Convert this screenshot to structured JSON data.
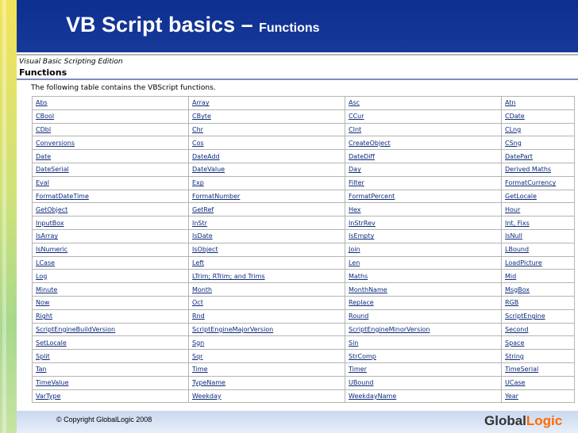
{
  "slide": {
    "title": "VB Script basics – ",
    "subtitle": "Functions"
  },
  "document": {
    "brand": "Visual Basic Scripting Edition",
    "heading": "Functions",
    "intro": "The following table contains the VBScript functions."
  },
  "functions_table": {
    "rows": [
      [
        "Abs",
        "Array",
        "Asc",
        "Atn"
      ],
      [
        "CBool",
        "CByte",
        "CCur",
        "CDate"
      ],
      [
        "CDbl",
        "Chr",
        "CInt",
        "CLng"
      ],
      [
        "Conversions",
        "Cos",
        "CreateObject",
        "CSng"
      ],
      [
        "Date",
        "DateAdd",
        "DateDiff",
        "DatePart"
      ],
      [
        "DateSerial",
        "DateValue",
        "Day",
        "Derived Maths"
      ],
      [
        "Eval",
        "Exp",
        "Filter",
        "FormatCurrency"
      ],
      [
        "FormatDateTime",
        "FormatNumber",
        "FormatPercent",
        "GetLocale"
      ],
      [
        "GetObject",
        "GetRef",
        "Hex",
        "Hour"
      ],
      [
        "InputBox",
        "InStr",
        "InStrRev",
        "Int, Fixs"
      ],
      [
        "IsArray",
        "IsDate",
        "IsEmpty",
        "IsNull"
      ],
      [
        "IsNumeric",
        "IsObject",
        "Join",
        "LBound"
      ],
      [
        "LCase",
        "Left",
        "Len",
        "LoadPicture"
      ],
      [
        "Log",
        "LTrim; RTrim; and Trims",
        "Maths",
        "Mid"
      ],
      [
        "Minute",
        "Month",
        "MonthName",
        "MsgBox"
      ],
      [
        "Now",
        "Oct",
        "Replace",
        "RGB"
      ],
      [
        "Right",
        "Rnd",
        "Round",
        "ScriptEngine"
      ],
      [
        "ScriptEngineBuildVersion",
        "ScriptEngineMajorVersion",
        "ScriptEngineMinorVersion",
        "Second"
      ],
      [
        "SetLocale",
        "Sgn",
        "Sin",
        "Space"
      ],
      [
        "Split",
        "Sqr",
        "StrComp",
        "String"
      ],
      [
        "Tan",
        "Time",
        "Timer",
        "TimeSerial"
      ],
      [
        "TimeValue",
        "TypeName",
        "UBound",
        "UCase"
      ],
      [
        "VarType",
        "Weekday",
        "WeekdayName",
        "Year"
      ]
    ]
  },
  "footer": {
    "copyright_symbol": "©",
    "copyright": " Copyright GlobalLogic 2008",
    "logo_part1": "Global",
    "logo_part2": "Logic"
  },
  "colors": {
    "header_blue": "#0d2f8f",
    "logo_orange": "#ff6a00",
    "link_blue": "#0b2a7a"
  }
}
